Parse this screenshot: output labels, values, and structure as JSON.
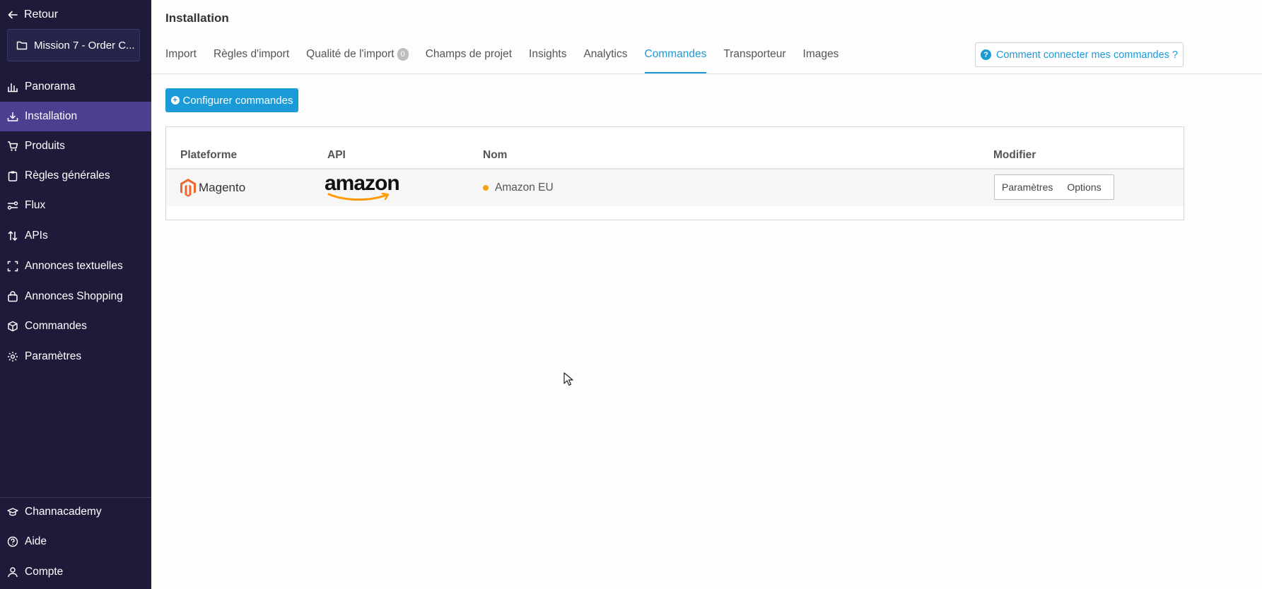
{
  "sidebar": {
    "back_label": "Retour",
    "project_label": "Mission 7 - Order C...",
    "items": [
      {
        "label": "Panorama",
        "icon": "bar-chart-icon"
      },
      {
        "label": "Installation",
        "icon": "download-tray-icon",
        "active": true
      },
      {
        "label": "Produits",
        "icon": "cart-icon"
      },
      {
        "label": "Règles générales",
        "icon": "clipboard-icon"
      },
      {
        "label": "Flux",
        "icon": "flow-icon"
      },
      {
        "label": "APIs",
        "icon": "sort-arrows-icon"
      },
      {
        "label": "Annonces textuelles",
        "icon": "frame-corners-icon"
      },
      {
        "label": "Annonces Shopping",
        "icon": "shopping-bag-icon"
      },
      {
        "label": "Commandes",
        "icon": "box-icon"
      },
      {
        "label": "Paramètres",
        "icon": "gear-icon"
      }
    ],
    "bottom_items": [
      {
        "label": "Channacademy",
        "icon": "graduation-cap-icon"
      },
      {
        "label": "Aide",
        "icon": "question-circle-icon"
      },
      {
        "label": "Compte",
        "icon": "user-icon"
      }
    ]
  },
  "header": {
    "title": "Installation",
    "tabs": [
      {
        "label": "Import"
      },
      {
        "label": "Règles d'import"
      },
      {
        "label": "Qualité de l'import",
        "badge": "0"
      },
      {
        "label": "Champs de projet"
      },
      {
        "label": "Insights"
      },
      {
        "label": "Analytics"
      },
      {
        "label": "Commandes",
        "active": true
      },
      {
        "label": "Transporteur"
      },
      {
        "label": "Images"
      }
    ],
    "help_label": "Comment connecter mes commandes ?"
  },
  "main": {
    "configure_label": "Configurer commandes",
    "table": {
      "columns": [
        "Plateforme",
        "API",
        "Nom",
        "Modifier"
      ],
      "rows": [
        {
          "platform": "Magento",
          "api": "amazon",
          "name": "Amazon EU",
          "status_color": "#f0a30a",
          "actions": [
            "Paramètres",
            "Options"
          ]
        }
      ]
    }
  },
  "colors": {
    "sidebar_bg": "#1e1b3a",
    "sidebar_active": "#4d3f8f",
    "accent": "#1a9ad6",
    "magento_orange": "#ee672f",
    "amazon_smile": "#ff9900"
  }
}
